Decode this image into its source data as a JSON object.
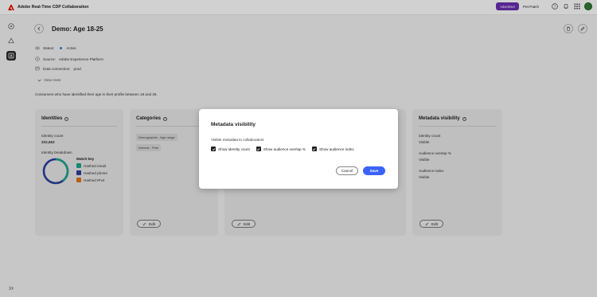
{
  "app": {
    "title": "Adobe Real-Time CDP Collaboration",
    "badge": "Advertiser",
    "org": "Pet Patch"
  },
  "colors": {
    "accent": "#3b63fb",
    "brand": "#eb1000",
    "badge": "#6a2fb3",
    "status_active": "#2680eb"
  },
  "page": {
    "title": "Demo: Age 18-25",
    "status_label": "Status:",
    "status_value": "Active",
    "source_label": "Source:",
    "source_value": "Adobe Experience Platform",
    "connection_label": "Data connection:",
    "connection_value": "prod",
    "view_more": "View more",
    "description": "Consumers who have identified their age in their profile between 18 and 25."
  },
  "identities": {
    "title": "Identities",
    "count_label": "Identity count",
    "count_value": "202,663",
    "breakdown_label": "Identity breakdown",
    "match_key_label": "Match key",
    "legend": [
      {
        "label": "Hashed email",
        "color": "#1aa88c"
      },
      {
        "label": "Hashed phone",
        "color": "#2b3f9e"
      },
      {
        "label": "Hashed IPv4",
        "color": "#e0741b"
      }
    ],
    "edit": "Edit"
  },
  "categories": {
    "title": "Categories",
    "tags": [
      "Demographic - Age range",
      "Interest - Pets"
    ],
    "edit": "Edit"
  },
  "third_card": {
    "edit": "Edit"
  },
  "metadata": {
    "title": "Metadata visibility",
    "items": [
      {
        "label": "Identity count",
        "value": "Visible"
      },
      {
        "label": "Audience overlap %",
        "value": "Visible"
      },
      {
        "label": "Audience index",
        "value": "Visible"
      }
    ],
    "edit": "Edit"
  },
  "modal": {
    "title": "Metadata visibility",
    "subtitle": "Visible metadata to collaborators",
    "options": [
      {
        "label": "Show identity count",
        "checked": true
      },
      {
        "label": "Show audience overlap %",
        "checked": true
      },
      {
        "label": "Show audience index",
        "checked": true
      }
    ],
    "cancel": "Cancel",
    "save": "Save"
  }
}
